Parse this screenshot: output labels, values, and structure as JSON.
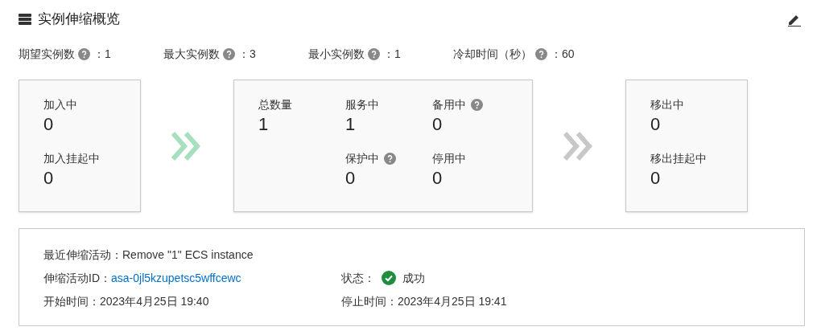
{
  "header": {
    "title": "实例伸缩概览"
  },
  "settings": [
    {
      "label": "期望实例数",
      "help": true,
      "value": "：1"
    },
    {
      "label": "最大实例数",
      "help": true,
      "value": "：3"
    },
    {
      "label": "最小实例数",
      "help": true,
      "value": "：1"
    },
    {
      "label": "冷却时间（秒）",
      "help": true,
      "value": "：60"
    }
  ],
  "panels": [
    {
      "kind": "stack",
      "items": [
        {
          "kind": "stat",
          "label": "加入中",
          "help": false,
          "value": "0"
        },
        {
          "kind": "stat",
          "label": "加入挂起中",
          "help": false,
          "value": "0"
        }
      ]
    },
    {
      "kind": "grid",
      "items": [
        {
          "kind": "stat",
          "label": "总数量",
          "help": false,
          "value": "1"
        },
        {
          "kind": "stat",
          "label": "服务中",
          "help": false,
          "value": "1"
        },
        {
          "kind": "stat",
          "label": "备用中",
          "help": true,
          "value": "0"
        },
        {
          "kind": "blank"
        },
        {
          "kind": "stat",
          "label": "保护中",
          "help": true,
          "value": "0"
        },
        {
          "kind": "stat",
          "label": "停用中",
          "help": false,
          "value": "0"
        }
      ]
    },
    {
      "kind": "stack",
      "items": [
        {
          "kind": "stat",
          "label": "移出中",
          "help": false,
          "value": "0"
        },
        {
          "kind": "stat",
          "label": "移出挂起中",
          "help": false,
          "value": "0"
        }
      ]
    }
  ],
  "flows": [
    {
      "active": true
    },
    {
      "active": false
    }
  ],
  "activity": {
    "recent_label": "最近伸缩活动：",
    "recent_value": "Remove \"1\" ECS instance",
    "id_label": "伸缩活动ID：",
    "id_value": "asa-0jl5kzupetsc5wffcewc",
    "status_label": "状态：",
    "status_text": "成功",
    "succeeded": true,
    "start_label": "开始时间：",
    "start_value": "2023年4月25日 19:40",
    "stop_label": "停止时间：",
    "stop_value": "2023年4月25日 19:41"
  }
}
